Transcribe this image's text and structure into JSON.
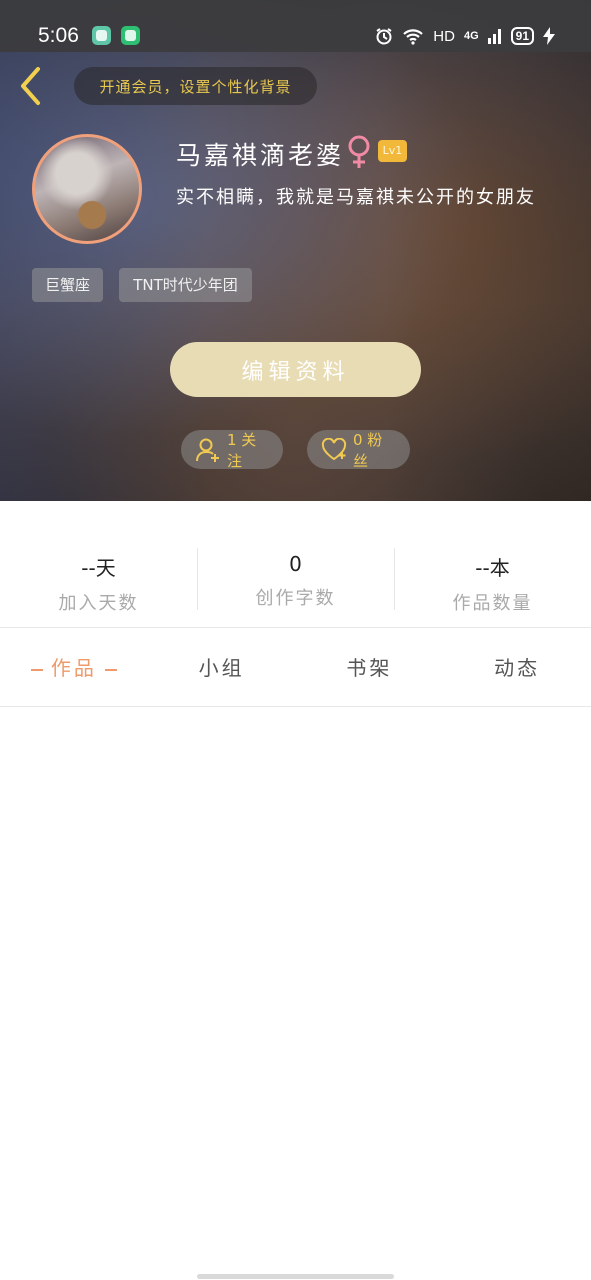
{
  "status_bar": {
    "time": "5:06",
    "network_label": "HD",
    "signal_label": "4G",
    "battery": "91"
  },
  "header": {
    "member_banner": "开通会员，设置个性化背景",
    "nickname": "马嘉祺滴老婆",
    "level_badge": "Lv1",
    "bio": "实不相瞒，我就是马嘉祺未公开的女朋友",
    "tags": [
      "巨蟹座",
      "TNT时代少年团"
    ],
    "edit_button": "编辑资料",
    "following": "1 关注",
    "fans": "0 粉丝",
    "gender_color": "#f08aa5",
    "accent": "#f1ca52"
  },
  "stats": [
    {
      "value": "--天",
      "label": "加入天数"
    },
    {
      "value": "0",
      "label": "创作字数"
    },
    {
      "value": "--本",
      "label": "作品数量"
    }
  ],
  "tabs": [
    {
      "label": "作品",
      "active": true
    },
    {
      "label": "小组",
      "active": false
    },
    {
      "label": "书架",
      "active": false
    },
    {
      "label": "动态",
      "active": false
    }
  ],
  "colors": {
    "active_tab": "#ef9a6a",
    "edit_button_bg": "#e8dcb5",
    "avatar_border": "#f0a07a"
  }
}
